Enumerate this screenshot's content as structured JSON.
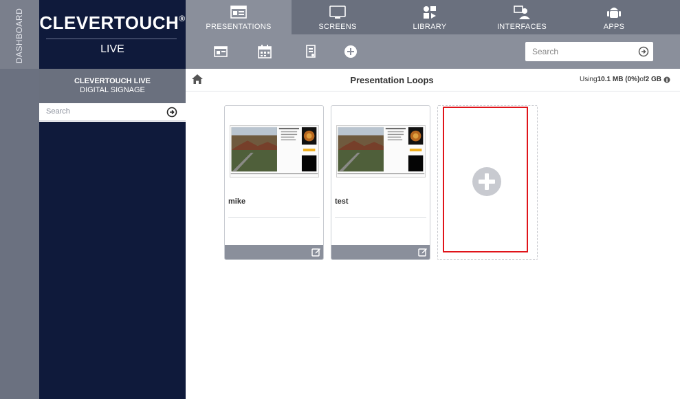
{
  "sidebar": {
    "dashboard_label": "DASHBOARD"
  },
  "brand": {
    "name": "CLEVERTOUCH",
    "reg": "®",
    "product": "LIVE"
  },
  "nav": {
    "tabs": [
      {
        "label": "PRESENTATIONS",
        "icon": "presentation-icon",
        "active": true
      },
      {
        "label": "SCREENS",
        "icon": "monitor-icon",
        "active": false
      },
      {
        "label": "LIBRARY",
        "icon": "media-library-icon",
        "active": false
      },
      {
        "label": "INTERFACES",
        "icon": "interface-user-icon",
        "active": false
      },
      {
        "label": "APPS",
        "icon": "android-icon",
        "active": false
      }
    ]
  },
  "toolbar": {
    "icons": [
      "presentation-icon",
      "calendar-icon",
      "page-icon",
      "add-circle-icon"
    ],
    "search_placeholder": "Search"
  },
  "left_panel": {
    "title": "CLEVERTOUCH LIVE",
    "subtitle": "DIGITAL SIGNAGE",
    "search_placeholder": "Search"
  },
  "main": {
    "title": "Presentation Loops",
    "usage_prefix": "Using ",
    "usage_amount": "10.1 MB (0%)",
    "usage_mid": " of ",
    "usage_total": "2 GB",
    "cards": [
      {
        "name": "mike"
      },
      {
        "name": "test"
      }
    ]
  },
  "colors": {
    "navy": "#0f1a3b",
    "nav_gray": "#6a707e",
    "active_gray": "#8a8f9b",
    "highlight_red": "#e0141a"
  }
}
